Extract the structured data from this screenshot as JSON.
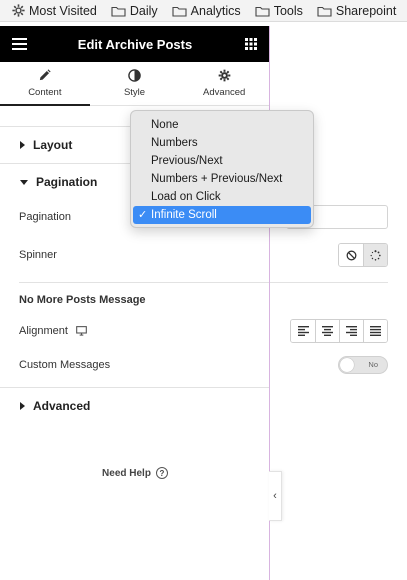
{
  "bookmarks": [
    {
      "label": "Most Visited",
      "icon": "gear-icon"
    },
    {
      "label": "Daily",
      "icon": "folder-icon"
    },
    {
      "label": "Analytics",
      "icon": "folder-icon"
    },
    {
      "label": "Tools",
      "icon": "folder-icon"
    },
    {
      "label": "Sharepoint",
      "icon": "folder-icon"
    }
  ],
  "panel": {
    "title": "Edit Archive Posts",
    "tabs": [
      {
        "label": "Content",
        "icon": "pencil-icon",
        "active": true
      },
      {
        "label": "Style",
        "icon": "half-circle-icon",
        "active": false
      },
      {
        "label": "Advanced",
        "icon": "gear-icon",
        "active": false
      }
    ]
  },
  "sections": {
    "layout": "Layout",
    "pagination": "Pagination",
    "advanced": "Advanced"
  },
  "controls": {
    "pagination_label": "Pagination",
    "spinner_label": "Spinner",
    "no_more_posts_heading": "No More Posts Message",
    "alignment_label": "Alignment",
    "custom_messages_label": "Custom Messages",
    "custom_messages_toggle": "No"
  },
  "dropdown": {
    "options": [
      "None",
      "Numbers",
      "Previous/Next",
      "Numbers + Previous/Next",
      "Load on Click",
      "Infinite Scroll"
    ],
    "selected": "Infinite Scroll",
    "check": "✓"
  },
  "footer": {
    "need_help": "Need Help",
    "help_icon": "?"
  },
  "collapse_arrow": "‹",
  "colors": {
    "header_bg": "#000000",
    "selected_option": "#3b8cf5",
    "guide_line": "#d8b4e0"
  }
}
